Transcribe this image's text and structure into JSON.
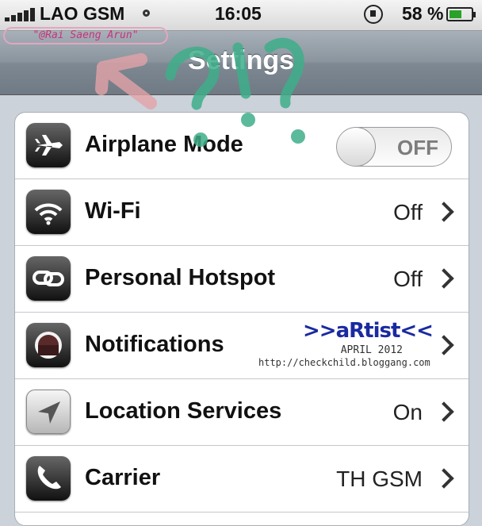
{
  "status_bar": {
    "carrier": "LAO GSM",
    "time": "16:05",
    "battery_percent": "58 %",
    "battery_level": 0.58,
    "signal_bars": 5,
    "icons": [
      "signal-bars-icon",
      "activity-dot-icon",
      "rotation-lock-icon",
      "battery-icon"
    ]
  },
  "overlay": {
    "handle": "\"@Rai Saeng Arun\""
  },
  "nav": {
    "title": "Settings"
  },
  "settings": {
    "items": [
      {
        "label": "Airplane Mode",
        "icon": "airplane-icon",
        "control": "switch",
        "value": "OFF"
      },
      {
        "label": "Wi-Fi",
        "icon": "wifi-icon",
        "value": "Off"
      },
      {
        "label": "Personal Hotspot",
        "icon": "hotspot-link-icon",
        "value": "Off"
      },
      {
        "label": "Notifications",
        "icon": "notifications-icon",
        "value": ""
      },
      {
        "label": "Location Services",
        "icon": "location-arrow-icon",
        "value": "On"
      },
      {
        "label": "Carrier",
        "icon": "phone-icon",
        "value": "TH GSM"
      }
    ]
  },
  "watermark": {
    "logo": ">>aRtist<<",
    "date": "APRIL 2012",
    "url": "http://checkchild.bloggang.com"
  }
}
